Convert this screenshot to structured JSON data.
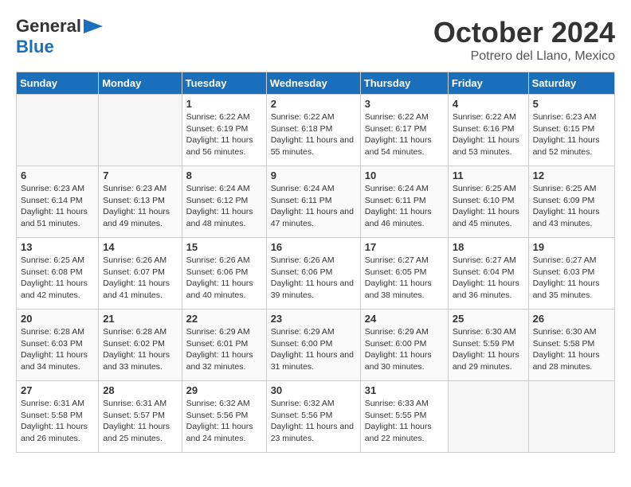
{
  "logo": {
    "general": "General",
    "blue": "Blue"
  },
  "title": "October 2024",
  "location": "Potrero del Llano, Mexico",
  "days_header": [
    "Sunday",
    "Monday",
    "Tuesday",
    "Wednesday",
    "Thursday",
    "Friday",
    "Saturday"
  ],
  "weeks": [
    [
      {
        "day": "",
        "info": ""
      },
      {
        "day": "",
        "info": ""
      },
      {
        "day": "1",
        "info": "Sunrise: 6:22 AM\nSunset: 6:19 PM\nDaylight: 11 hours and 56 minutes."
      },
      {
        "day": "2",
        "info": "Sunrise: 6:22 AM\nSunset: 6:18 PM\nDaylight: 11 hours and 55 minutes."
      },
      {
        "day": "3",
        "info": "Sunrise: 6:22 AM\nSunset: 6:17 PM\nDaylight: 11 hours and 54 minutes."
      },
      {
        "day": "4",
        "info": "Sunrise: 6:22 AM\nSunset: 6:16 PM\nDaylight: 11 hours and 53 minutes."
      },
      {
        "day": "5",
        "info": "Sunrise: 6:23 AM\nSunset: 6:15 PM\nDaylight: 11 hours and 52 minutes."
      }
    ],
    [
      {
        "day": "6",
        "info": "Sunrise: 6:23 AM\nSunset: 6:14 PM\nDaylight: 11 hours and 51 minutes."
      },
      {
        "day": "7",
        "info": "Sunrise: 6:23 AM\nSunset: 6:13 PM\nDaylight: 11 hours and 49 minutes."
      },
      {
        "day": "8",
        "info": "Sunrise: 6:24 AM\nSunset: 6:12 PM\nDaylight: 11 hours and 48 minutes."
      },
      {
        "day": "9",
        "info": "Sunrise: 6:24 AM\nSunset: 6:11 PM\nDaylight: 11 hours and 47 minutes."
      },
      {
        "day": "10",
        "info": "Sunrise: 6:24 AM\nSunset: 6:11 PM\nDaylight: 11 hours and 46 minutes."
      },
      {
        "day": "11",
        "info": "Sunrise: 6:25 AM\nSunset: 6:10 PM\nDaylight: 11 hours and 45 minutes."
      },
      {
        "day": "12",
        "info": "Sunrise: 6:25 AM\nSunset: 6:09 PM\nDaylight: 11 hours and 43 minutes."
      }
    ],
    [
      {
        "day": "13",
        "info": "Sunrise: 6:25 AM\nSunset: 6:08 PM\nDaylight: 11 hours and 42 minutes."
      },
      {
        "day": "14",
        "info": "Sunrise: 6:26 AM\nSunset: 6:07 PM\nDaylight: 11 hours and 41 minutes."
      },
      {
        "day": "15",
        "info": "Sunrise: 6:26 AM\nSunset: 6:06 PM\nDaylight: 11 hours and 40 minutes."
      },
      {
        "day": "16",
        "info": "Sunrise: 6:26 AM\nSunset: 6:06 PM\nDaylight: 11 hours and 39 minutes."
      },
      {
        "day": "17",
        "info": "Sunrise: 6:27 AM\nSunset: 6:05 PM\nDaylight: 11 hours and 38 minutes."
      },
      {
        "day": "18",
        "info": "Sunrise: 6:27 AM\nSunset: 6:04 PM\nDaylight: 11 hours and 36 minutes."
      },
      {
        "day": "19",
        "info": "Sunrise: 6:27 AM\nSunset: 6:03 PM\nDaylight: 11 hours and 35 minutes."
      }
    ],
    [
      {
        "day": "20",
        "info": "Sunrise: 6:28 AM\nSunset: 6:03 PM\nDaylight: 11 hours and 34 minutes."
      },
      {
        "day": "21",
        "info": "Sunrise: 6:28 AM\nSunset: 6:02 PM\nDaylight: 11 hours and 33 minutes."
      },
      {
        "day": "22",
        "info": "Sunrise: 6:29 AM\nSunset: 6:01 PM\nDaylight: 11 hours and 32 minutes."
      },
      {
        "day": "23",
        "info": "Sunrise: 6:29 AM\nSunset: 6:00 PM\nDaylight: 11 hours and 31 minutes."
      },
      {
        "day": "24",
        "info": "Sunrise: 6:29 AM\nSunset: 6:00 PM\nDaylight: 11 hours and 30 minutes."
      },
      {
        "day": "25",
        "info": "Sunrise: 6:30 AM\nSunset: 5:59 PM\nDaylight: 11 hours and 29 minutes."
      },
      {
        "day": "26",
        "info": "Sunrise: 6:30 AM\nSunset: 5:58 PM\nDaylight: 11 hours and 28 minutes."
      }
    ],
    [
      {
        "day": "27",
        "info": "Sunrise: 6:31 AM\nSunset: 5:58 PM\nDaylight: 11 hours and 26 minutes."
      },
      {
        "day": "28",
        "info": "Sunrise: 6:31 AM\nSunset: 5:57 PM\nDaylight: 11 hours and 25 minutes."
      },
      {
        "day": "29",
        "info": "Sunrise: 6:32 AM\nSunset: 5:56 PM\nDaylight: 11 hours and 24 minutes."
      },
      {
        "day": "30",
        "info": "Sunrise: 6:32 AM\nSunset: 5:56 PM\nDaylight: 11 hours and 23 minutes."
      },
      {
        "day": "31",
        "info": "Sunrise: 6:33 AM\nSunset: 5:55 PM\nDaylight: 11 hours and 22 minutes."
      },
      {
        "day": "",
        "info": ""
      },
      {
        "day": "",
        "info": ""
      }
    ]
  ]
}
